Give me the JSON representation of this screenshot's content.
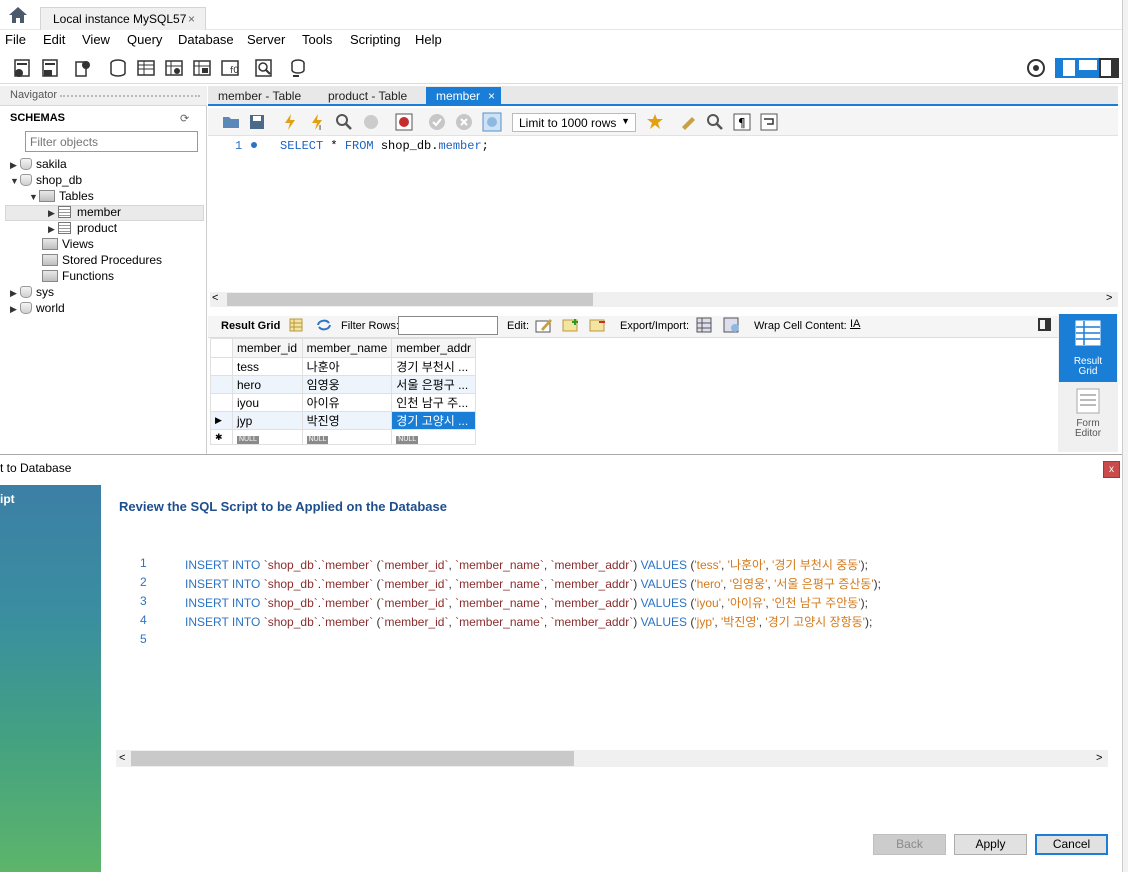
{
  "window": {
    "tab_title": "Local instance MySQL57",
    "tab_close": "×"
  },
  "menu": [
    "File",
    "Edit",
    "View",
    "Query",
    "Database",
    "Server",
    "Tools",
    "Scripting",
    "Help"
  ],
  "navigator": {
    "header": "Navigator",
    "schemas_label": "SCHEMAS",
    "filter_placeholder": "Filter objects",
    "tree": {
      "sakila": "sakila",
      "shop_db": "shop_db",
      "tables": "Tables",
      "member": "member",
      "product": "product",
      "views": "Views",
      "procs": "Stored Procedures",
      "funcs": "Functions",
      "sys": "sys",
      "world": "world"
    }
  },
  "query_tabs": [
    "member - Table",
    "product - Table",
    "member"
  ],
  "query_tab_close": "×",
  "sql_toolbar": {
    "limit": "Limit to 1000 rows"
  },
  "editor": {
    "line": "1",
    "code_kw1": "SELECT",
    "code_mid": " * ",
    "code_kw2": "FROM",
    "code_rest": " shop_db.",
    "code_tbl": "member",
    "code_end": ";"
  },
  "result_bar": {
    "result_grid": "Result Grid",
    "filter_rows": "Filter Rows:",
    "edit": "Edit:",
    "export": "Export/Import:",
    "wrap": "Wrap Cell Content:"
  },
  "grid": {
    "headers": [
      "member_id",
      "member_name",
      "member_addr"
    ],
    "rows": [
      [
        "tess",
        "나훈아",
        "경기 부천시 ..."
      ],
      [
        "hero",
        "임영웅",
        "서울 은평구 ..."
      ],
      [
        "iyou",
        "아이유",
        "인천 남구 주..."
      ],
      [
        "jyp",
        "박진영",
        "경기 고양시 ..."
      ]
    ],
    "null": "NULL"
  },
  "side_buttons": {
    "result_grid_1": "Result",
    "result_grid_2": "Grid",
    "form_editor_1": "Form",
    "form_editor_2": "Editor"
  },
  "dialog": {
    "title": "t to Database",
    "close": "x",
    "side_label": "ipt",
    "heading": "Review the SQL Script to be Applied on the Database",
    "lines": [
      {
        "n": "1",
        "id": "tess",
        "name": "나훈아",
        "addr": "경기 부천시 중동"
      },
      {
        "n": "2",
        "id": "hero",
        "name": "임영웅",
        "addr": "서울 은평구 증산동"
      },
      {
        "n": "3",
        "id": "iyou",
        "name": "아이유",
        "addr": "인천 남구 주안동"
      },
      {
        "n": "4",
        "id": "jyp",
        "name": "박진영",
        "addr": "경기 고양시 장항동"
      }
    ],
    "line5": "5",
    "sql_kw1": "INSERT INTO",
    "sql_db": "`shop_db`",
    "sql_dot": ".",
    "sql_tbl": "`member`",
    "sql_open": " (",
    "sql_c1": "`member_id`",
    "sql_c2": "`member_name`",
    "sql_c3": "`member_addr`",
    "sql_close": ") ",
    "sql_kw2": "VALUES",
    "sql_comma": ", ",
    "buttons": {
      "back": "Back",
      "apply": "Apply",
      "cancel": "Cancel"
    }
  },
  "colors": {
    "accent": "#1a7ed7",
    "keyword": "#2b73c6",
    "identifier": "#8a2d2d",
    "string": "#d4791a"
  }
}
